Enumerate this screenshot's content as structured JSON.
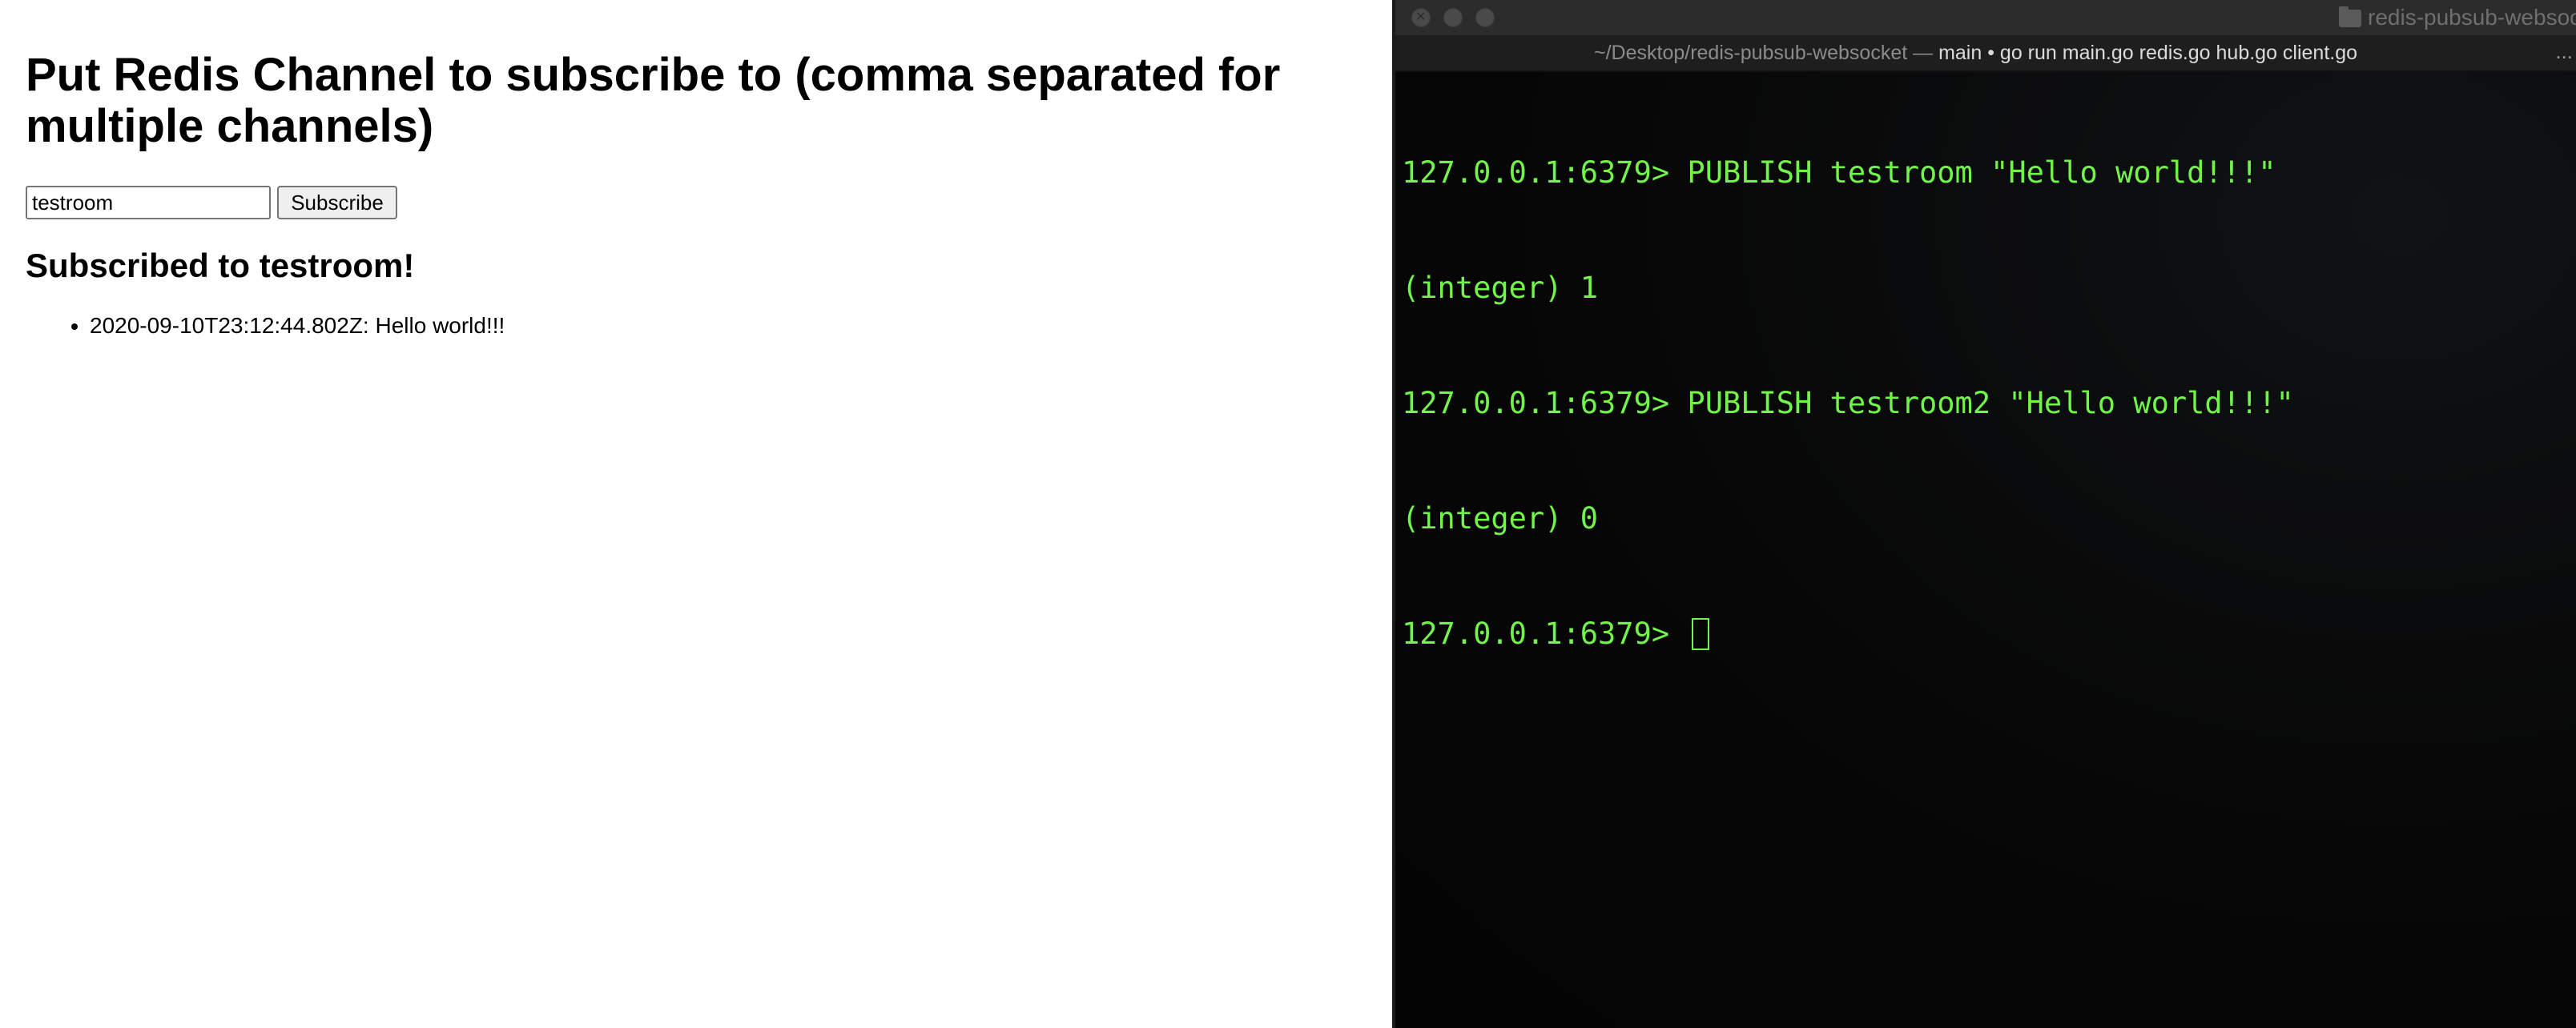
{
  "browser": {
    "heading": "Put Redis Channel to subscribe to (comma separated for multiple channels)",
    "channel_input_value": "testroom",
    "subscribe_label": "Subscribe",
    "status": "Subscribed to testroom!",
    "messages": [
      "2020-09-10T23:12:44.802Z: Hello world!!!"
    ]
  },
  "terminal": {
    "window_title": "redis-pubsub-websoc",
    "tab_path": "~/Desktop/redis-pubsub-websocket — ",
    "tab_command": "main • go run main.go redis.go hub.go client.go",
    "tab_ellipsis": "...",
    "lines": [
      "127.0.0.1:6379> PUBLISH testroom \"Hello world!!!\"",
      "(integer) 1",
      "127.0.0.1:6379> PUBLISH testroom2 \"Hello world!!!\"",
      "(integer) 0"
    ],
    "prompt": "127.0.0.1:6379> ",
    "text_color": "#72f54a",
    "icons": [
      "close-icon",
      "minimize-icon",
      "maximize-icon",
      "folder-icon"
    ]
  }
}
